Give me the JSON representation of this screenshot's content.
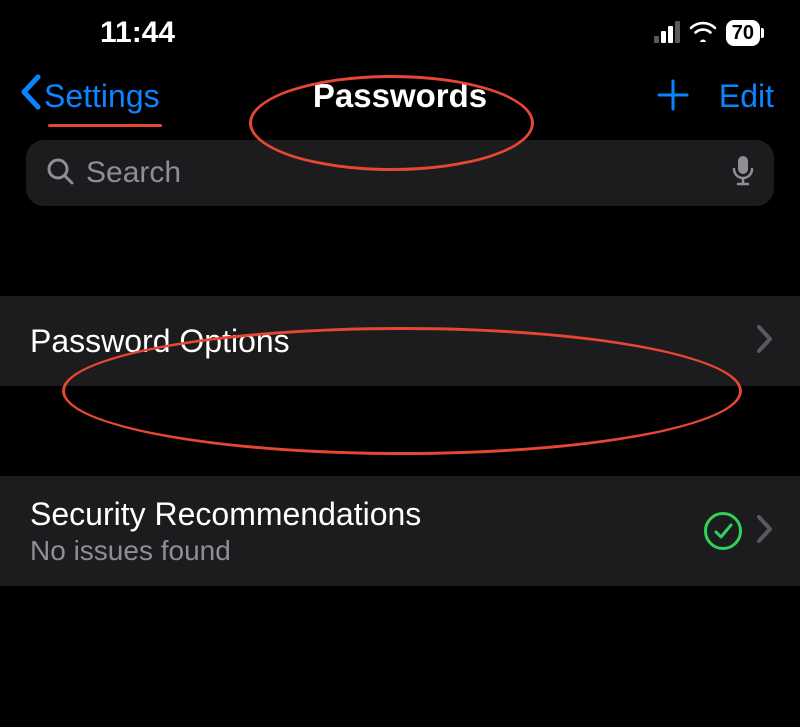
{
  "status": {
    "time": "11:44",
    "battery": "70"
  },
  "nav": {
    "back_label": "Settings",
    "title": "Passwords",
    "edit_label": "Edit"
  },
  "search": {
    "placeholder": "Search"
  },
  "rows": {
    "password_options": {
      "title": "Password Options"
    },
    "security": {
      "title": "Security Recommendations",
      "subtitle": "No issues found"
    }
  },
  "colors": {
    "accent": "#0a84ff",
    "annotation": "#e64634",
    "success": "#30d158",
    "row_bg": "#1c1c1e",
    "secondary_text": "#8e8e93"
  }
}
